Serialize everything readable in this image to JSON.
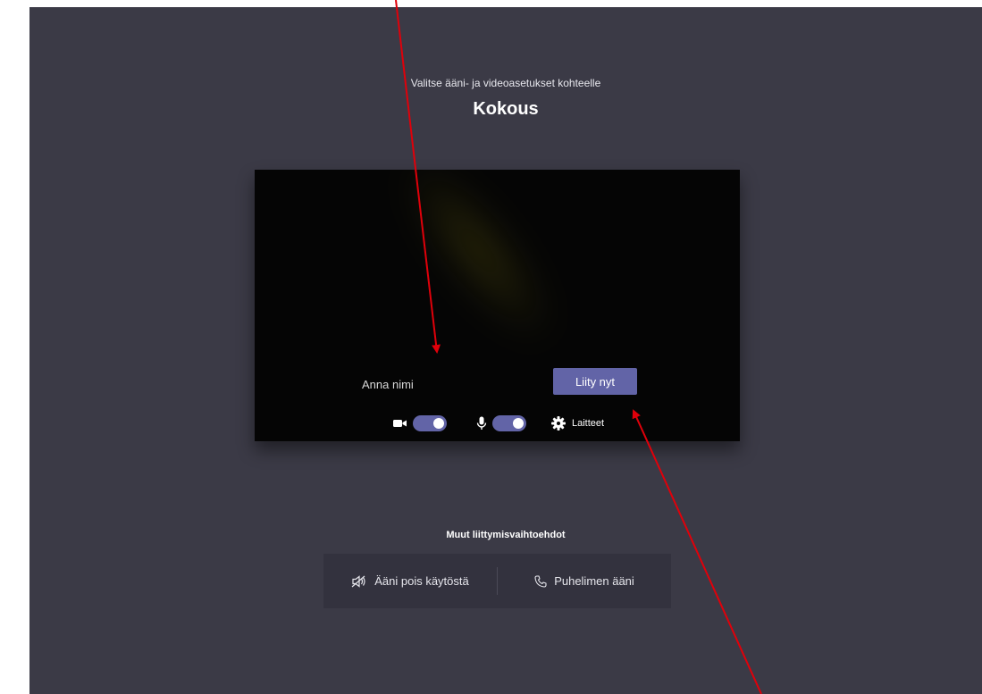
{
  "prejoin": {
    "subtitle": "Valitse ääni- ja videoasetukset kohteelle",
    "meeting_title": "Kokous"
  },
  "video_card": {
    "name_placeholder": "Anna nimi",
    "join_button_label": "Liity nyt",
    "camera_icon": "video-camera-icon",
    "camera_on": true,
    "mic_icon": "microphone-icon",
    "mic_on": true,
    "devices_icon": "gear-icon",
    "devices_label": "Laitteet"
  },
  "other_options": {
    "title": "Muut liittymisvaihtoehdot",
    "audio_off_icon": "speaker-muted-icon",
    "audio_off_label": "Ääni pois käytöstä",
    "phone_icon": "phone-icon",
    "phone_label": "Puhelimen ääni"
  },
  "colors": {
    "background": "#3b3a46",
    "accent": "#6264a7",
    "annotation_arrow": "#e0000a"
  }
}
